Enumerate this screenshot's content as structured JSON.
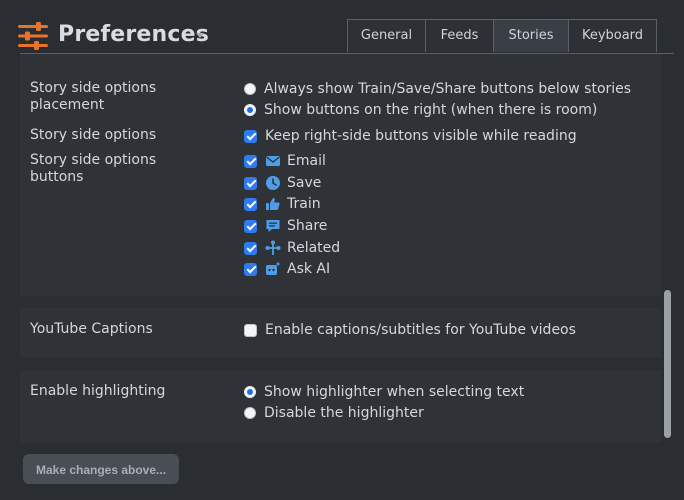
{
  "header": {
    "title": "Preferences",
    "tabs": [
      {
        "label": "General",
        "active": false
      },
      {
        "label": "Feeds",
        "active": false
      },
      {
        "label": "Stories",
        "active": true
      },
      {
        "label": "Keyboard",
        "active": false
      }
    ]
  },
  "colors": {
    "accent": "#2f7bf0",
    "icon_orange": "#e8732a",
    "icon_blue": "#4f9de8"
  },
  "sections": {
    "placement": {
      "label": "Story side options placement",
      "options": [
        {
          "label": "Always show Train/Save/Share buttons below stories",
          "selected": false
        },
        {
          "label": "Show buttons on the right (when there is room)",
          "selected": true
        }
      ]
    },
    "side_options": {
      "label": "Story side options",
      "checkbox": {
        "label": "Keep right-side buttons visible while reading",
        "checked": true
      }
    },
    "side_buttons": {
      "label": "Story side options buttons",
      "items": [
        {
          "label": "Email",
          "icon": "email-icon",
          "checked": true
        },
        {
          "label": "Save",
          "icon": "clock-icon",
          "checked": true
        },
        {
          "label": "Train",
          "icon": "thumbs-up-icon",
          "checked": true
        },
        {
          "label": "Share",
          "icon": "comment-icon",
          "checked": true
        },
        {
          "label": "Related",
          "icon": "branch-icon",
          "checked": true
        },
        {
          "label": "Ask AI",
          "icon": "ai-sparkle-icon",
          "checked": true
        }
      ]
    },
    "youtube": {
      "label": "YouTube Captions",
      "checkbox": {
        "label": "Enable captions/subtitles for YouTube videos",
        "checked": false
      }
    },
    "highlighting": {
      "label": "Enable highlighting",
      "options": [
        {
          "label": "Show highlighter when selecting text",
          "selected": true
        },
        {
          "label": "Disable the highlighter",
          "selected": false
        }
      ]
    }
  },
  "footer": {
    "button_label": "Make changes above..."
  }
}
